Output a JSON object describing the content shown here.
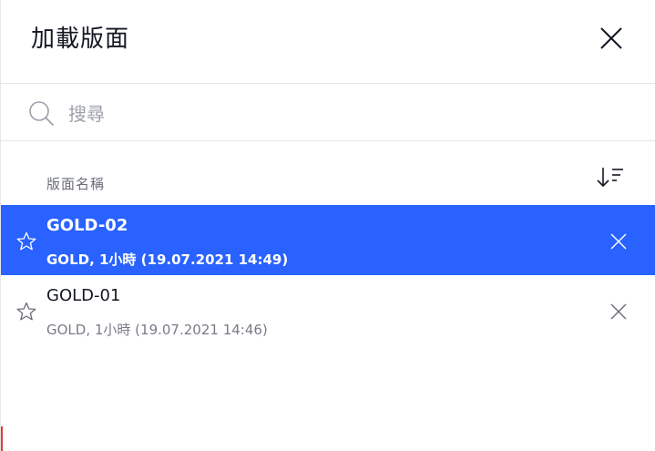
{
  "dialog": {
    "title": "加載版面",
    "close_icon": "close-icon"
  },
  "search": {
    "placeholder": "搜尋",
    "value": "",
    "icon": "search-icon"
  },
  "list_header": {
    "column_label": "版面名稱",
    "sort_icon": "sort-icon"
  },
  "layouts": [
    {
      "name": "GOLD-02",
      "details": "GOLD, 1小時 (19.07.2021 14:49)",
      "selected": true
    },
    {
      "name": "GOLD-01",
      "details": "GOLD, 1小時 (19.07.2021 14:46)",
      "selected": false
    }
  ],
  "colors": {
    "selected_row": "#2962ff",
    "text_primary": "#131722",
    "text_secondary": "#787b86",
    "divider": "#e6e6e6"
  }
}
